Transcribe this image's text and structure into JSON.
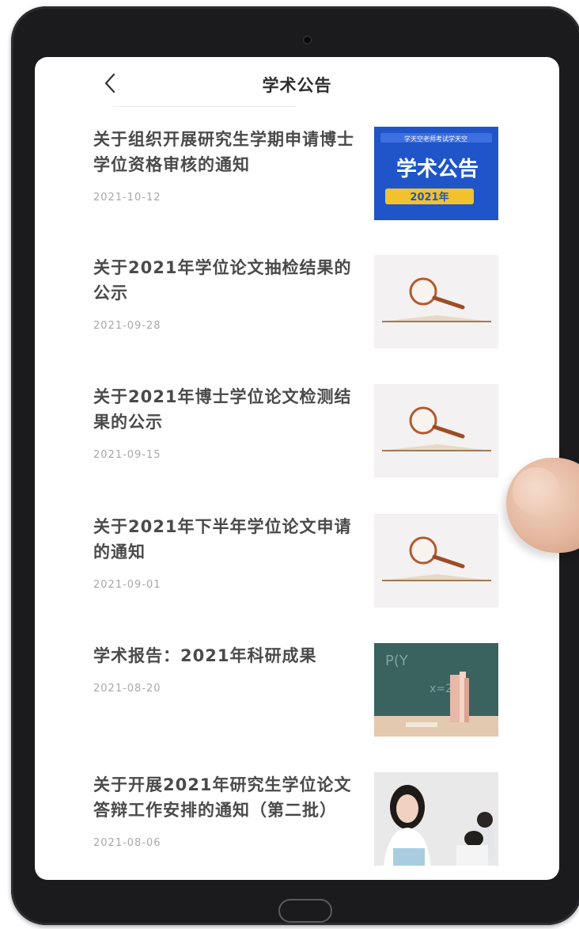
{
  "header": {
    "title": "学术公告"
  },
  "articles": [
    {
      "title": "关于组织开展研究生学期申请博士学位资格审核的通知",
      "meta": "2021-10-12",
      "thumb": {
        "text_top": "学天空老师考试学天空",
        "text_main": "学术公告",
        "badge": "2021年"
      }
    },
    {
      "title": "关于2021年学位论文抽检结果的公示",
      "meta": "2021-09-28",
      "thumb": {}
    },
    {
      "title": "关于2021年博士学位论文检测结果的公示",
      "meta": "2021-09-15",
      "thumb": {}
    },
    {
      "title": "关于2021年下半年学位论文申请的通知",
      "meta": "2021-09-01",
      "thumb": {}
    },
    {
      "title": "学术报告：2021年科研成果",
      "meta": "2021-08-20",
      "thumb": {}
    },
    {
      "title": "关于开展2021年研究生学位论文答辩工作安排的通知（第二批）",
      "meta": "2021-08-06",
      "thumb": {}
    }
  ]
}
